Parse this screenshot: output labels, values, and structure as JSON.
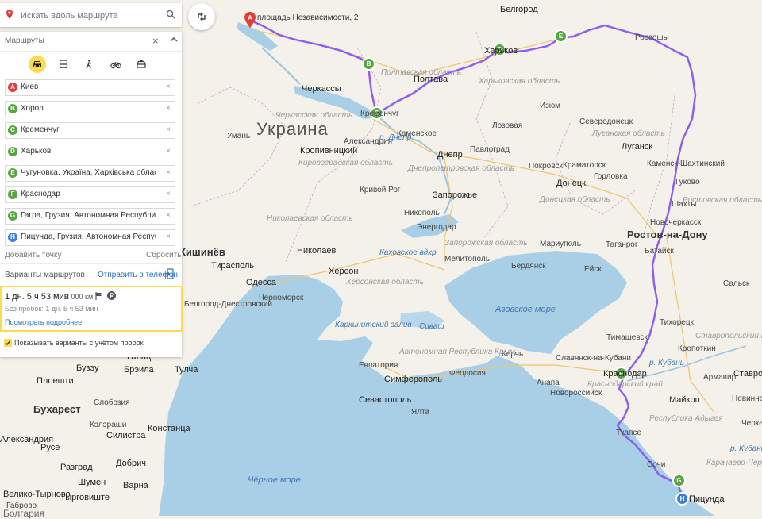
{
  "search": {
    "placeholder": "Искать вдоль маршрута"
  },
  "panel": {
    "title": "Маршруты",
    "modes": [
      "car-icon",
      "bus-icon",
      "walk-icon",
      "bike-icon",
      "taxi-icon"
    ],
    "waypoints": [
      {
        "letter": "A",
        "text": "Киев",
        "color": "#e53a35"
      },
      {
        "letter": "B",
        "text": "Хорол",
        "color": "#58a642"
      },
      {
        "letter": "C",
        "text": "Кременчуг",
        "color": "#58a642"
      },
      {
        "letter": "D",
        "text": "Харьков",
        "color": "#58a642"
      },
      {
        "letter": "E",
        "text": "Чугуновка, Україна, Харківська область, Великобурлуцький район",
        "color": "#58a642"
      },
      {
        "letter": "F",
        "text": "Краснодар",
        "color": "#58a642"
      },
      {
        "letter": "G",
        "text": "Гагра, Грузия, Автономная Республика Абхазия",
        "color": "#58a642"
      },
      {
        "letter": "H",
        "text": "Пицунда, Грузия, Автономная Республика Абхазия",
        "color": "#3b7fe0"
      }
    ],
    "add_point": "Добавить точку",
    "reset": "Сбросить",
    "variants": "Варианты маршрутов",
    "send_phone": "Отправить в телефон",
    "route": {
      "time": "1 дн. 5 ч 53 мин",
      "distance": "2 000 км",
      "no_traffic": "Без пробок: 1 дн. 5 ч 53 мин",
      "details": "Посмотреть подробнее"
    },
    "traffic_option": "Показывать варианты с учётом пробок"
  },
  "map": {
    "start_label": "площадь Независимости, 2",
    "country": "Украина",
    "cities": {
      "belgorod": "Белгород",
      "kharkov": "Харьков",
      "poltava": "Полтава",
      "cherkassy": "Черкассы",
      "kremenchug": "Кременчуг",
      "uman": "Умань",
      "kropyvnytskyi": "Кропивницкий",
      "alexandria": "Александрия",
      "kamenskoe": "Каменское",
      "dnepr": "Днепр",
      "pavlograd": "Павлоград",
      "izyum": "Изюм",
      "lozovaya": "Лозовая",
      "severodonetsk": "Северодонецк",
      "lugansk": "Луганск",
      "kramatorsk": "Краматорск",
      "pokrovsk": "Покровск",
      "gorlovka": "Горловка",
      "donetsk": "Донецк",
      "krivoy_rog": "Кривой Рог",
      "zaporozhye": "Запорожье",
      "nikopol": "Никополь",
      "energodar": "Энергодар",
      "nikolaev": "Николаев",
      "kherson": "Херсон",
      "melitopol": "Мелитополь",
      "mariupol": "Мариуполь",
      "berdyansk": "Бердянск",
      "taganrog": "Таганрог",
      "rostov": "Ростов-на-Дону",
      "bataysk": "Батайск",
      "novocherkassk": "Новочеркасск",
      "shakhty": "Шахты",
      "gukovo": "Гуково",
      "kamensk": "Каменск-Шахтинский",
      "rossosh": "Россошь",
      "odessa": "Одесса",
      "chisinau": "Кишинёв",
      "tiraspol": "Тирасполь",
      "chernomorsk": "Черноморск",
      "belgorod_dn": "Белгород-Днестровский",
      "evpatoria": "Евпатория",
      "simferopol": "Симферополь",
      "sevastopol": "Севастополь",
      "yalta": "Ялта",
      "feodosia": "Феодосия",
      "kerch": "Керчь",
      "slavyansk": "Славянск-на-Кубани",
      "krasnodar": "Краснодар",
      "novorossiysk": "Новороссийск",
      "anapa": "Анапа",
      "timashevsk": "Тимашевск",
      "tikhoretsk": "Тихорецк",
      "kropotkin": "Кропоткин",
      "armavir": "Армавир",
      "stavropol": "Ставрополь",
      "maykop": "Майкоп",
      "nevinnomyssk": "Невинномысск",
      "cherkessk": "Черкесск",
      "tuapse": "Туапсе",
      "sochi": "Сочи",
      "pitsunda": "Пицунда",
      "salsk": "Сальск",
      "eysk": "Ейск",
      "bucharest": "Бухарест",
      "ploiesti": "Плоешти",
      "buzau": "Бузэу",
      "braila": "Брэила",
      "galati": "Галац",
      "tulcea": "Тулча",
      "constanta": "Констанца",
      "slobozia": "Слобозия",
      "calarasi": "Кэлэраши",
      "silistra": "Силистра",
      "dobrich": "Добрич",
      "varna": "Варна",
      "shumen": "Шумен",
      "razgrad": "Разград",
      "ruse": "Русе",
      "alexandria_ro": "Александрия",
      "veliko": "Велико-Тырново",
      "gabrovo": "Габрово",
      "bulgaria": "Болгария",
      "targoviste": "Тырговиште",
      "kamenskoe2": "Каменское"
    },
    "regions": {
      "poltava_obl": "Полтавская область",
      "kharkov_obl": "Харьковская область",
      "cherkassy_obl": "Черкасская область",
      "kirovograd_obl": "Кировоградская область",
      "dnepr_obl": "Днепропетровская область",
      "lugansk_obl": "Луганская область",
      "donetsk_obl": "Донецкая область",
      "zaporozhye_obl": "Запорожская область",
      "nikolaev_obl": "Николаевская область",
      "kherson_obl": "Херсонская область",
      "rostov_obl": "Ростовская область",
      "crimea": "Автономная Республика Крым",
      "krasnodar_kr": "Краснодарский край",
      "adygea": "Республика Адыгея",
      "stavropol_kr": "Ставропольский край",
      "kar_cherk": "Карачаево-Черкесская"
    },
    "waters": {
      "azov": "Азовское море",
      "black": "Чёрное море",
      "kakhovka": "Каховское вдхр.",
      "karkinit": "Каркинитский залив",
      "sivash": "Сиваш",
      "dnepr_r": "р. Днепр",
      "kuban_r": "р. Кубань",
      "kuban_r2": "р. Кубань"
    },
    "roads": [
      "M-03",
      "E-58",
      "M-14",
      "E-58",
      "M-17",
      "M-26",
      "P-260",
      "M-4",
      "A-260",
      "M-4",
      "P-217",
      "M-4",
      "P-217",
      "M-4"
    ]
  },
  "colors": {
    "route": "#8b5cf6",
    "accent": "#ffdb4d",
    "link": "#2a73d1",
    "start_pin": "#e53a35",
    "via_pin": "#58a642",
    "end_pin": "#3b7fe0"
  }
}
